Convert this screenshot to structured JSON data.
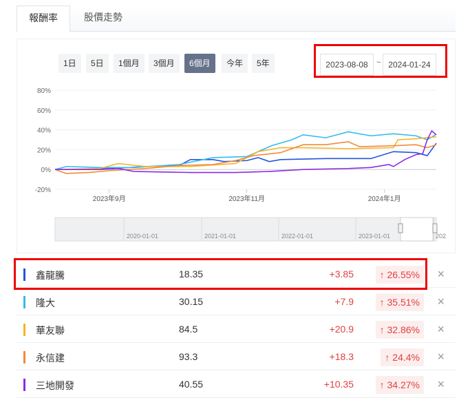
{
  "tabs": [
    {
      "label": "報酬率",
      "active": true
    },
    {
      "label": "股價走勢",
      "active": false
    }
  ],
  "ranges": [
    {
      "label": "1日"
    },
    {
      "label": "5日"
    },
    {
      "label": "1個月"
    },
    {
      "label": "3個月"
    },
    {
      "label": "6個月",
      "active": true
    },
    {
      "label": "今年"
    },
    {
      "label": "5年"
    }
  ],
  "date_range": {
    "start": "2023-08-08",
    "separator": "~",
    "end": "2024-01-24"
  },
  "navigator_labels": [
    "2020-01-01",
    "2021-01-01",
    "2022-01-01",
    "2023-01-01",
    "202"
  ],
  "chart_data": {
    "type": "line",
    "x_unit": "days since 2023-08-08",
    "xlim": [
      0,
      169
    ],
    "ylim": [
      -20,
      80
    ],
    "yticks": [
      "80%",
      "60%",
      "40%",
      "20%",
      "0%",
      "-20%"
    ],
    "ytick_values": [
      80,
      60,
      40,
      20,
      0,
      -20
    ],
    "xticks": [
      {
        "label": "2023年9月",
        "day": 24
      },
      {
        "label": "2023年11月",
        "day": 85
      },
      {
        "label": "2024年1月",
        "day": 146
      }
    ],
    "grid": true,
    "series": [
      {
        "name": "鑫龍騰",
        "color": "#2255dd",
        "points": [
          [
            0,
            0
          ],
          [
            10,
            0
          ],
          [
            25,
            1
          ],
          [
            40,
            3
          ],
          [
            55,
            4
          ],
          [
            60,
            10
          ],
          [
            70,
            10
          ],
          [
            75,
            8
          ],
          [
            85,
            9
          ],
          [
            90,
            12
          ],
          [
            95,
            8
          ],
          [
            100,
            10
          ],
          [
            120,
            11
          ],
          [
            130,
            11
          ],
          [
            140,
            11
          ],
          [
            150,
            18
          ],
          [
            160,
            17
          ],
          [
            165,
            14
          ],
          [
            169,
            26.5
          ]
        ]
      },
      {
        "name": "隆大",
        "color": "#33bbee",
        "points": [
          [
            0,
            0
          ],
          [
            5,
            3
          ],
          [
            20,
            2
          ],
          [
            35,
            2
          ],
          [
            55,
            5
          ],
          [
            70,
            12
          ],
          [
            85,
            13
          ],
          [
            92,
            20
          ],
          [
            96,
            24
          ],
          [
            105,
            30
          ],
          [
            110,
            35
          ],
          [
            120,
            32
          ],
          [
            130,
            38
          ],
          [
            140,
            34
          ],
          [
            150,
            36
          ],
          [
            160,
            34
          ],
          [
            165,
            30
          ],
          [
            169,
            35.5
          ]
        ]
      },
      {
        "name": "華友聯",
        "color": "#f5b428",
        "points": [
          [
            0,
            0
          ],
          [
            20,
            1
          ],
          [
            28,
            6
          ],
          [
            40,
            3
          ],
          [
            60,
            3
          ],
          [
            80,
            6
          ],
          [
            90,
            18
          ],
          [
            100,
            22
          ],
          [
            110,
            22
          ],
          [
            130,
            21
          ],
          [
            150,
            22
          ],
          [
            152,
            30
          ],
          [
            160,
            31
          ],
          [
            169,
            33
          ]
        ]
      },
      {
        "name": "永信建",
        "color": "#f08a3c",
        "points": [
          [
            0,
            0
          ],
          [
            5,
            -4
          ],
          [
            15,
            -3
          ],
          [
            25,
            -1
          ],
          [
            40,
            1
          ],
          [
            55,
            4
          ],
          [
            70,
            5
          ],
          [
            80,
            9
          ],
          [
            88,
            14
          ],
          [
            100,
            17
          ],
          [
            110,
            25
          ],
          [
            120,
            25
          ],
          [
            130,
            28
          ],
          [
            135,
            23
          ],
          [
            150,
            24
          ],
          [
            160,
            25
          ],
          [
            165,
            22
          ],
          [
            169,
            25
          ]
        ]
      },
      {
        "name": "三地開發",
        "color": "#8a2be2",
        "points": [
          [
            0,
            0
          ],
          [
            20,
            0
          ],
          [
            28,
            1
          ],
          [
            35,
            -2
          ],
          [
            60,
            -3
          ],
          [
            80,
            -3
          ],
          [
            95,
            -2
          ],
          [
            110,
            0
          ],
          [
            130,
            1
          ],
          [
            140,
            2
          ],
          [
            148,
            5
          ],
          [
            150,
            3
          ],
          [
            155,
            10
          ],
          [
            160,
            15
          ],
          [
            163,
            16
          ],
          [
            165,
            30
          ],
          [
            167,
            39
          ],
          [
            169,
            35
          ]
        ]
      }
    ]
  },
  "stocks": [
    {
      "name": "鑫龍騰",
      "color": "#2255dd",
      "price": "18.35",
      "change": "+3.85",
      "pct": "26.55%",
      "arrow": "↑"
    },
    {
      "name": "隆大",
      "color": "#33bbee",
      "price": "30.15",
      "change": "+7.9",
      "pct": "35.51%",
      "arrow": "↑"
    },
    {
      "name": "華友聯",
      "color": "#f5b428",
      "price": "84.5",
      "change": "+20.9",
      "pct": "32.86%",
      "arrow": "↑"
    },
    {
      "name": "永信建",
      "color": "#f08a3c",
      "price": "93.3",
      "change": "+18.3",
      "pct": "24.4%",
      "arrow": "↑"
    },
    {
      "name": "三地開發",
      "color": "#8a2be2",
      "price": "40.55",
      "change": "+10.35",
      "pct": "34.27%",
      "arrow": "↑"
    }
  ],
  "close_glyph": "×"
}
